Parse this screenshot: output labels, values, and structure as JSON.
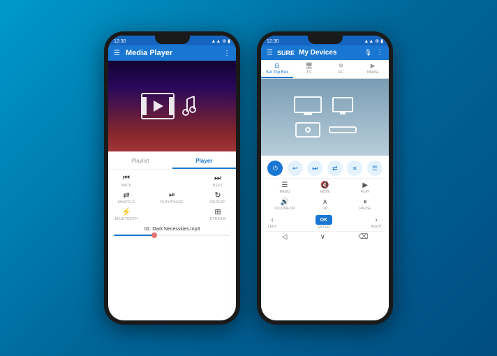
{
  "background": {
    "gradient_start": "#0099cc",
    "gradient_end": "#004d80"
  },
  "phone_left": {
    "status_bar": {
      "time": "12:30",
      "signal": "▲▲▲",
      "wifi": "WiFi",
      "battery": "■"
    },
    "header": {
      "title": "Media Player",
      "menu_icon": "☰",
      "more_icon": "⋮"
    },
    "tabs": {
      "playlist": "Playlist",
      "player": "Player"
    },
    "controls": {
      "back": "BACK",
      "next": "NEXT",
      "shuffle": "SHUFFLE",
      "play_pause": "PLAY/PAUSE",
      "repeat": "REPEAT",
      "bluetooth": "BLUETOOTH",
      "stream": "STREAM"
    },
    "song_title": "02. Dark Necessities.mp3",
    "progress_percent": 35
  },
  "phone_right": {
    "status_bar": {
      "time": "12:30",
      "signal": "▲▲▲",
      "wifi": "WiFi",
      "battery": "■"
    },
    "header": {
      "logo": "SURE",
      "title": "My Devices",
      "mic_icon": "🎤",
      "more_icon": "⋮",
      "menu_icon": "☰"
    },
    "device_tabs": [
      {
        "label": "Set Top Box",
        "icon": "📺"
      },
      {
        "label": "TV",
        "icon": "🖥"
      },
      {
        "label": "AC",
        "icon": "❄"
      },
      {
        "label": "Media",
        "icon": "▶"
      }
    ],
    "remote_top": [
      {
        "icon": "⏻",
        "label": "",
        "style": "power"
      },
      {
        "icon": "↩",
        "label": ""
      },
      {
        "icon": "⏭",
        "label": ""
      },
      {
        "icon": "⇄",
        "label": ""
      },
      {
        "icon": "📋",
        "label": ""
      },
      {
        "icon": "📄",
        "label": ""
      }
    ],
    "remote_grid": [
      {
        "icon": "☰",
        "label": "MENU"
      },
      {
        "icon": "🔇",
        "label": "MUTE"
      },
      {
        "icon": "▶",
        "label": "PLAY"
      },
      {
        "icon": "🔊",
        "label": "VOLUME UP"
      },
      {
        "icon": "∧",
        "label": "UP"
      },
      {
        "icon": "⏸",
        "label": "PAUSE"
      }
    ],
    "dpad": {
      "left": "LEFT",
      "ok": "OK",
      "enter": "ENTER",
      "right": "RIGHT",
      "up": "UP"
    },
    "bottom_controls": [
      {
        "icon": "◁",
        "label": ""
      },
      {
        "icon": "∨",
        "label": ""
      },
      {
        "icon": "⌫",
        "label": ""
      }
    ]
  }
}
